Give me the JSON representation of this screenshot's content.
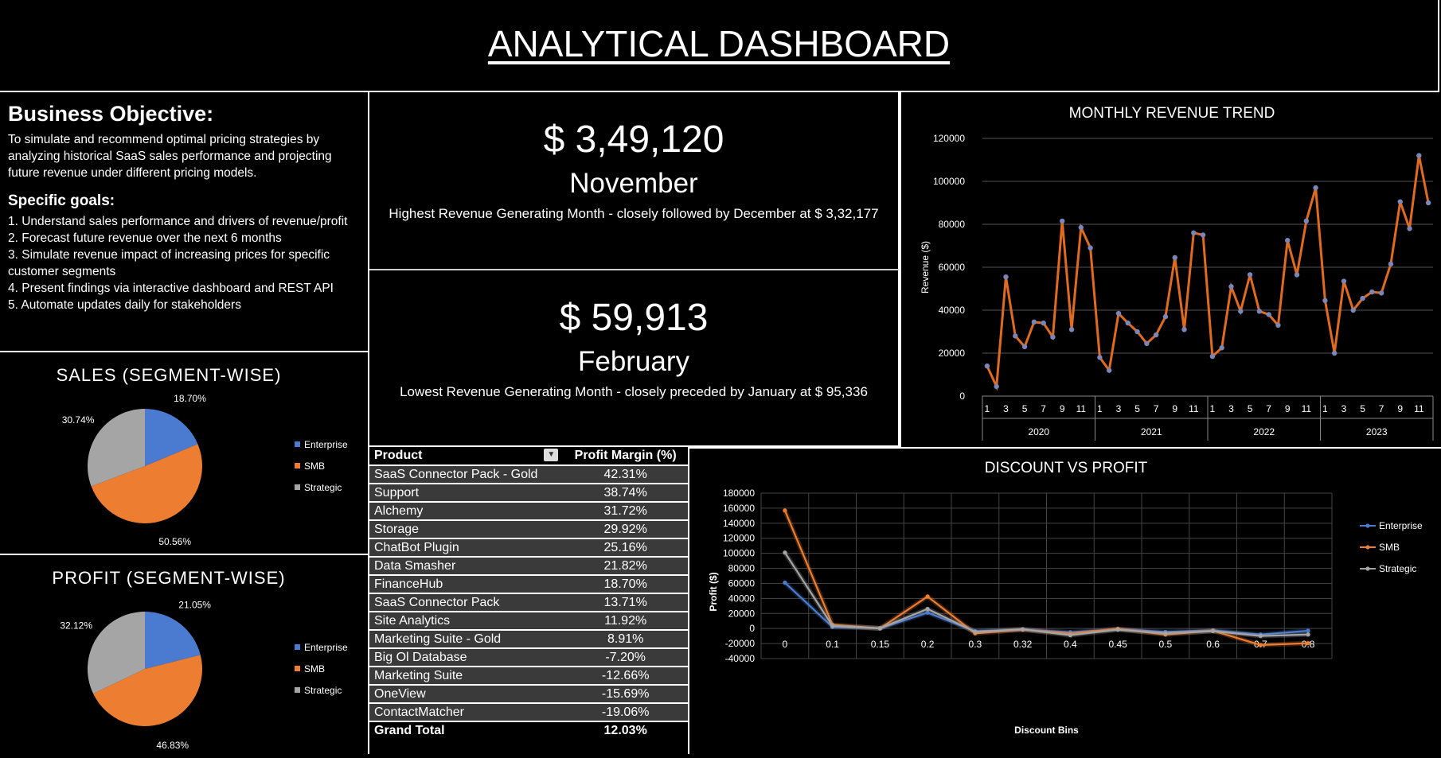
{
  "title": "ANALYTICAL DASHBOARD",
  "objective": {
    "heading": "Business Objective:",
    "text": "To simulate and recommend optimal pricing strategies by analyzing historical SaaS sales performance and projecting future revenue under different pricing models.",
    "goals_heading": "Specific goals:",
    "goals": [
      "1. Understand sales performance and drivers of revenue/profit",
      "2. Forecast future revenue over the next 6 months",
      "3. Simulate revenue impact of increasing prices for specific customer segments",
      "4. Present findings via interactive dashboard and REST API",
      "5. Automate updates daily for stakeholders"
    ]
  },
  "kpi_high": {
    "value": "$ 3,49,120",
    "month": "November",
    "note": "Highest Revenue Generating Month - closely followed by December at $ 3,32,177"
  },
  "kpi_low": {
    "value": "$ 59,913",
    "month": "February",
    "note": "Lowest Revenue Generating Month - closely preceded by January at $ 95,336"
  },
  "colors": {
    "enterprise": "#4a7bd1",
    "smb": "#ed7d31",
    "strategic": "#a5a5a5",
    "revenue_line": "#e06b1f",
    "revenue_marker": "#7a86b8"
  },
  "table": {
    "headers": [
      "Product",
      "Profit Margin (%)"
    ],
    "rows": [
      [
        "SaaS Connector Pack - Gold",
        "42.31%"
      ],
      [
        "Support",
        "38.74%"
      ],
      [
        "Alchemy",
        "31.72%"
      ],
      [
        "Storage",
        "29.92%"
      ],
      [
        "ChatBot Plugin",
        "25.16%"
      ],
      [
        "Data Smasher",
        "21.82%"
      ],
      [
        "FinanceHub",
        "18.70%"
      ],
      [
        "SaaS Connector Pack",
        "13.71%"
      ],
      [
        "Site Analytics",
        "11.92%"
      ],
      [
        "Marketing Suite - Gold",
        "8.91%"
      ],
      [
        "Big Ol Database",
        "-7.20%"
      ],
      [
        "Marketing Suite",
        "-12.66%"
      ],
      [
        "OneView",
        "-15.69%"
      ],
      [
        "ContactMatcher",
        "-19.06%"
      ]
    ],
    "total_label": "Grand Total",
    "total_value": "12.03%"
  },
  "chart_data": [
    {
      "type": "pie",
      "title": "SALES (SEGMENT-WISE)",
      "categories": [
        "Enterprise",
        "SMB",
        "Strategic"
      ],
      "values": [
        18.7,
        50.56,
        30.74
      ],
      "labels": [
        "18.70%",
        "50.56%",
        "30.74%"
      ],
      "legend": "right"
    },
    {
      "type": "pie",
      "title": "PROFIT (SEGMENT-WISE)",
      "categories": [
        "Enterprise",
        "SMB",
        "Strategic"
      ],
      "values": [
        21.05,
        46.83,
        32.12
      ],
      "labels": [
        "21.05%",
        "46.83%",
        "32.12%"
      ],
      "legend": "right"
    },
    {
      "type": "line",
      "title": "MONTHLY REVENUE TREND",
      "ylabel": "Revenue ($)",
      "ylim": [
        0,
        120000
      ],
      "yticks": [
        0,
        20000,
        40000,
        60000,
        80000,
        100000,
        120000
      ],
      "years": [
        "2020",
        "2021",
        "2022",
        "2023"
      ],
      "month_ticks": [
        "1",
        "3",
        "5",
        "7",
        "9",
        "11"
      ],
      "grid": true,
      "values": [
        14000,
        4500,
        55500,
        28000,
        23000,
        34500,
        34000,
        27500,
        81500,
        31000,
        78500,
        69000,
        18000,
        12000,
        38500,
        34000,
        30000,
        24500,
        28500,
        37000,
        64500,
        31000,
        76000,
        75000,
        18500,
        22500,
        51000,
        39500,
        56500,
        39500,
        38000,
        33000,
        72500,
        56500,
        81500,
        97000,
        44500,
        20000,
        53500,
        40000,
        45500,
        48500,
        48000,
        61500,
        90500,
        78000,
        112000,
        90000
      ]
    },
    {
      "type": "line",
      "title": "DISCOUNT VS PROFIT",
      "xlabel": "Discount Bins",
      "ylabel": "Profit ($)",
      "categories": [
        "0",
        "0.1",
        "0.15",
        "0.2",
        "0.3",
        "0.32",
        "0.4",
        "0.45",
        "0.5",
        "0.6",
        "0.7",
        "0.8"
      ],
      "ylim": [
        -40000,
        180000
      ],
      "yticks": [
        -40000,
        -20000,
        0,
        20000,
        40000,
        60000,
        80000,
        100000,
        120000,
        140000,
        160000,
        180000
      ],
      "grid": true,
      "legend": "right",
      "series": [
        {
          "name": "Enterprise",
          "values": [
            61000,
            2000,
            200,
            21000,
            -3500,
            -1500,
            -5000,
            -1000,
            -4500,
            -2500,
            -8000,
            -3000
          ]
        },
        {
          "name": "SMB",
          "values": [
            157000,
            5000,
            200,
            42500,
            -6500,
            -1500,
            -7000,
            -500,
            -8000,
            -3000,
            -22000,
            -19500
          ]
        },
        {
          "name": "Strategic",
          "values": [
            101000,
            3500,
            300,
            26000,
            -4500,
            -1000,
            -9000,
            -1500,
            -6500,
            -3500,
            -10000,
            -8000
          ]
        }
      ]
    }
  ]
}
